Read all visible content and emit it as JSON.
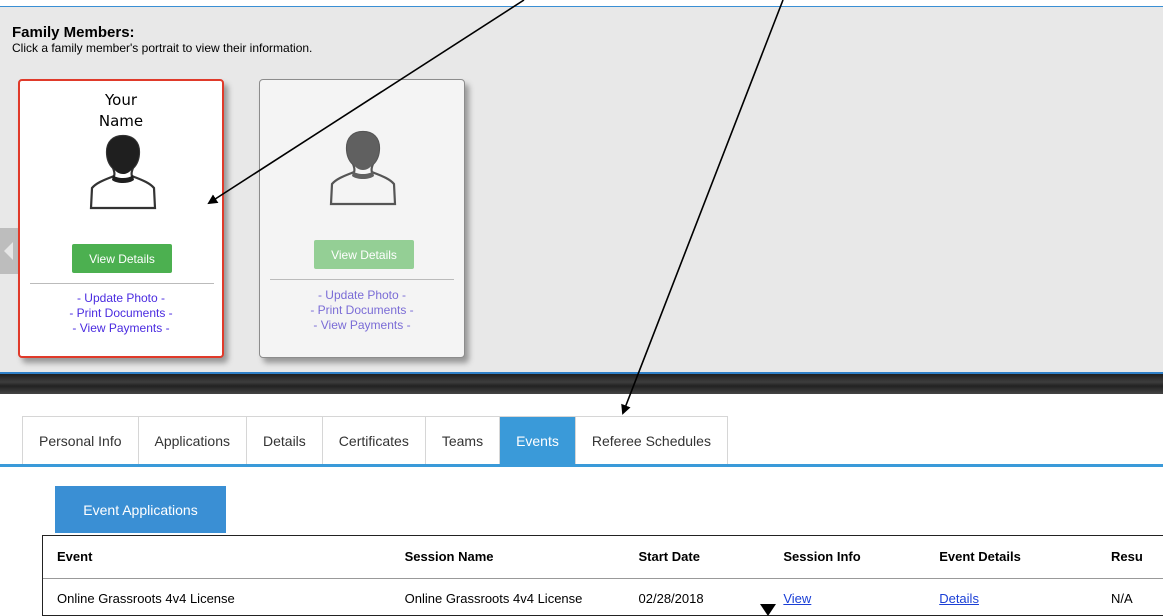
{
  "family": {
    "title": "Family Members:",
    "subtitle": "Click a family member's portrait to view their information.",
    "cards": [
      {
        "name_line1": "Your",
        "name_line2": "Name",
        "view_label": "View Details",
        "links": [
          "- Update Photo -",
          "- Print Documents -",
          "- View Payments -"
        ]
      },
      {
        "name_line1": "",
        "name_line2": "",
        "view_label": "View Details",
        "links": [
          "- Update Photo -",
          "- Print Documents -",
          "- View Payments -"
        ]
      }
    ]
  },
  "tabs": [
    {
      "label": "Personal Info"
    },
    {
      "label": "Applications"
    },
    {
      "label": "Details"
    },
    {
      "label": "Certificates"
    },
    {
      "label": "Teams"
    },
    {
      "label": "Events"
    },
    {
      "label": "Referee Schedules"
    }
  ],
  "active_tab": "Events",
  "subtab": {
    "label": "Event Applications"
  },
  "table": {
    "headers": [
      "Event",
      "Session Name",
      "Start Date",
      "Session Info",
      "Event Details",
      "Resu"
    ],
    "rows": [
      [
        "Online Grassroots 4v4 License",
        "Online Grassroots 4v4 License",
        "02/28/2018",
        "View",
        "Details",
        "N/A"
      ]
    ]
  },
  "colors": {
    "accent_blue": "#3a9ad9",
    "selected_border": "#e03a2a",
    "view_button_green": "#4cb050",
    "link_purple": "#4a2be0"
  },
  "icons": [
    "person-silhouette-icon",
    "left-arrow-icon",
    "annotation-arrow"
  ]
}
